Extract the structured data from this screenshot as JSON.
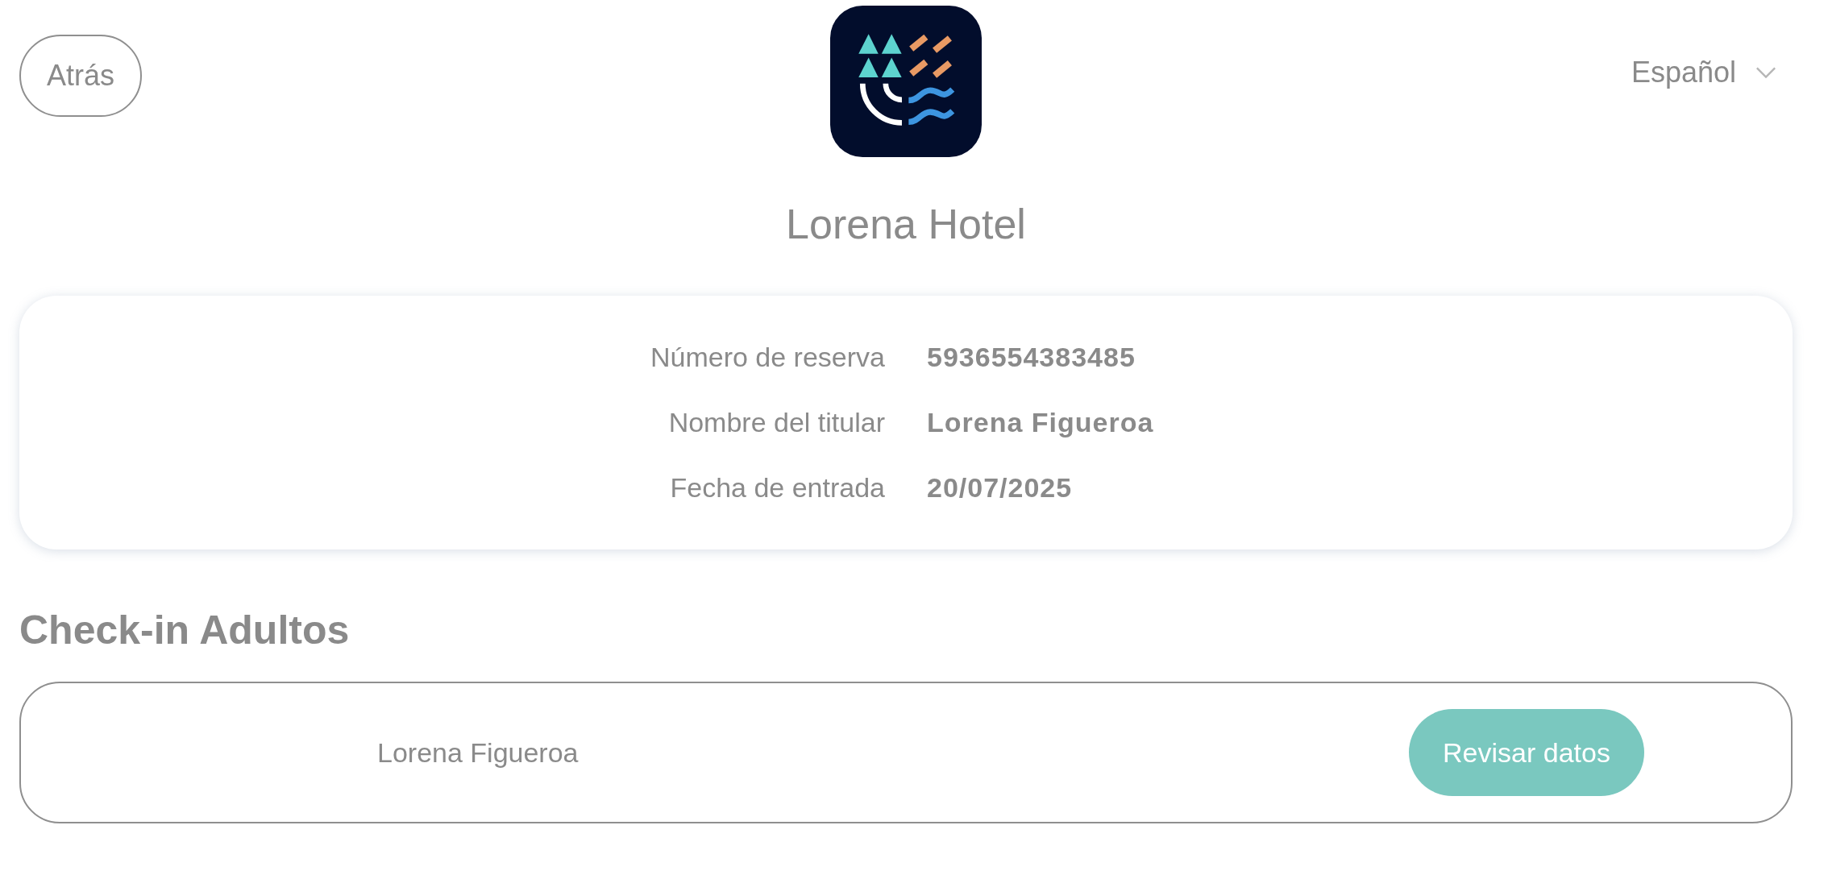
{
  "back_button": {
    "label": "Atrás"
  },
  "language_select": {
    "value": "Español"
  },
  "hotel_name": "Lorena Hotel",
  "reservation": [
    {
      "label": "Número de reserva",
      "value": "5936554383485"
    },
    {
      "label": "Nombre del titular",
      "value": "Lorena Figueroa"
    },
    {
      "label": "Fecha de entrada",
      "value": "20/07/2025"
    }
  ],
  "section_title": "Check-in Adultos",
  "guests": [
    {
      "name": "Lorena Figueroa",
      "button": "Revisar datos"
    }
  ]
}
